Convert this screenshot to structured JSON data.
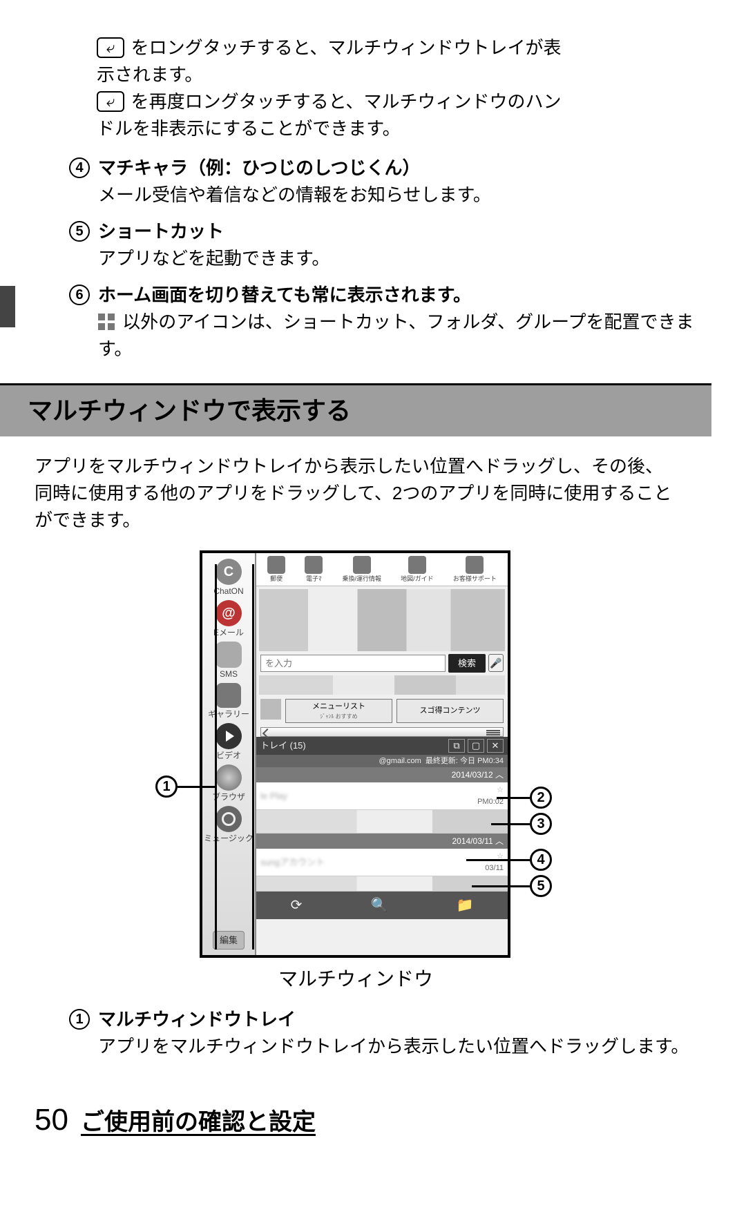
{
  "intro_lines": {
    "l1a": "をロングタッチすると、マルチウィンドウトレイが表",
    "l1b": "示されます。",
    "l2a": "を再度ロングタッチすると、マルチウィンドウのハン",
    "l2b": "ドルを非表示にすることができます。"
  },
  "back_glyph": "⤶",
  "items_top": [
    {
      "num": "4",
      "title": "マチキャラ（例：ひつじのしつじくん）",
      "desc": "メール受信や着信などの情報をお知らせします。"
    },
    {
      "num": "5",
      "title": "ショートカット",
      "desc": "アプリなどを起動できます。"
    },
    {
      "num": "6",
      "title": "ホーム画面を切り替えても常に表示されます。",
      "desc_prefix": "",
      "desc": "以外のアイコンは、ショートカット、フォルダ、グループを配置できます。",
      "has_icon": true
    }
  ],
  "section_title": "マルチウィンドウで表示する",
  "section_intro": "アプリをマルチウィンドウトレイから表示したい位置へドラッグし、その後、同時に使用する他のアプリをドラッグして、2つのアプリを同時に使用することができます。",
  "tray": {
    "items": [
      {
        "label": "ChatON",
        "kind": "c"
      },
      {
        "label": "Eメール",
        "kind": "mail"
      },
      {
        "label": "SMS",
        "kind": "bubble"
      },
      {
        "label": "ギャラリー",
        "kind": "sq"
      },
      {
        "label": "ビデオ",
        "kind": "play"
      },
      {
        "label": "ブラウザ",
        "kind": "globe"
      },
      {
        "label": "ミュージック",
        "kind": "music"
      }
    ],
    "edit": "編集"
  },
  "top_icons": [
    "郵便",
    "電子ﾏ",
    "乗換/運行情報",
    "地図/ガイド",
    "お客様サポート"
  ],
  "search": {
    "placeholder": "を入力",
    "button": "検索"
  },
  "pills": {
    "a": "メニューリスト",
    "a_sub": "ｼﾞｬﾝﾙ おすすめ",
    "b": "スゴ得コンテンツ"
  },
  "mail": {
    "header": "トレイ (15)",
    "account_suffix": "@gmail.com",
    "updated": "最終更新: 今日 PM0:34",
    "date1": "2014/03/12 ︿",
    "row1_left": "le Play",
    "row1_time": "PM0:02",
    "date2": "2014/03/11 ︿",
    "row2_left": "sungアカウント",
    "row2_time": "03/11"
  },
  "callout_labels": {
    "1": "1",
    "2": "2",
    "3": "3",
    "4": "4",
    "5": "5"
  },
  "fig_caption": "マルチウィンドウ",
  "items_bottom": [
    {
      "num": "1",
      "title": "マルチウィンドウトレイ",
      "desc": "アプリをマルチウィンドウトレイから表示したい位置へドラッグします。"
    }
  ],
  "footer": {
    "page": "50",
    "section": "ご使用前の確認と設定"
  }
}
